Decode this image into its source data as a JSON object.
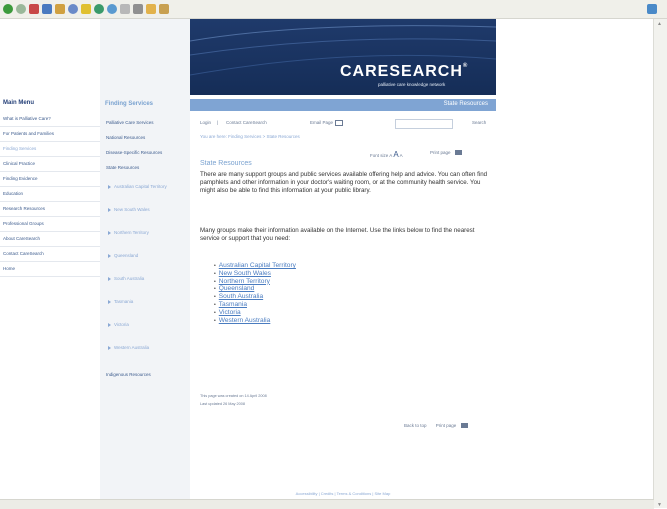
{
  "banner": {
    "logo_care": "CARE",
    "logo_search": "SEARCH",
    "logo_tm": "®",
    "tagline": "palliative care knowledge network"
  },
  "section_title": "State Resources",
  "main_menu": {
    "title": "Main Menu",
    "items": [
      {
        "label": "What is Palliative Care?"
      },
      {
        "label": "For Patients and Families"
      },
      {
        "label": "Finding Services"
      },
      {
        "label": "Clinical Practice"
      },
      {
        "label": "Finding Evidence"
      },
      {
        "label": "Education"
      },
      {
        "label": "Research Resources"
      },
      {
        "label": "Professional Groups"
      },
      {
        "label": "About CareSearch"
      },
      {
        "label": "Contact CareSearch"
      },
      {
        "label": "Home"
      }
    ]
  },
  "finding_services": {
    "title": "Finding Services",
    "items": [
      {
        "label": "Palliative Care Services"
      },
      {
        "label": "National Resources"
      },
      {
        "label": "Disease-Specific Resources"
      },
      {
        "label": "State Resources"
      }
    ],
    "states": [
      {
        "label": "Australian Capital Territory"
      },
      {
        "label": "New South Wales"
      },
      {
        "label": "Northern Territory"
      },
      {
        "label": "Queensland"
      },
      {
        "label": "South Australia"
      },
      {
        "label": "Tasmania"
      },
      {
        "label": "Victoria"
      },
      {
        "label": "Western Australia"
      }
    ],
    "indigenous": "Indigenous Resources"
  },
  "utility": {
    "login": "Login",
    "separator": "|",
    "contact": "Contact CareSearch",
    "email": "Email Page",
    "search_placeholder": "",
    "search_button": "Search"
  },
  "breadcrumb": "You are here: Finding Services > State Resources",
  "font_size": {
    "label": "Font size",
    "a_small": "A",
    "a_large": "A",
    "a_medium": "A"
  },
  "print_page": "Print page",
  "content": {
    "heading": "State Resources",
    "para1": "There are many support groups and public services available offering help and advice. You can often find pamphlets and other information in your doctor's waiting room, or at the community health service.  You might also be able to find this information at your public library.",
    "para2": "Many groups make their information available on the Internet. Use the links below to find the nearest service or support that you need:",
    "states": [
      {
        "label": "Australian Capital Territory"
      },
      {
        "label": "New South Wales"
      },
      {
        "label": "Northern Territory"
      },
      {
        "label": "Queensland"
      },
      {
        "label": "South Australia"
      },
      {
        "label": "Tasmania"
      },
      {
        "label": "Victoria"
      },
      {
        "label": "Western Australia"
      }
    ]
  },
  "created": "This page was created on 14 April 2008",
  "updated": "Last updated 26 May 2008",
  "back_to_top": "Back to top",
  "print_page_bottom": "Print page",
  "footer": "Accessibility  |  Credits  |  Terms & Conditions  |  Site Map",
  "colors": {
    "banner_dark": "#1f3a6b",
    "section_bar": "#7fa4d3",
    "link": "#4a7cc0",
    "menu_text": "#3b5a8c"
  }
}
